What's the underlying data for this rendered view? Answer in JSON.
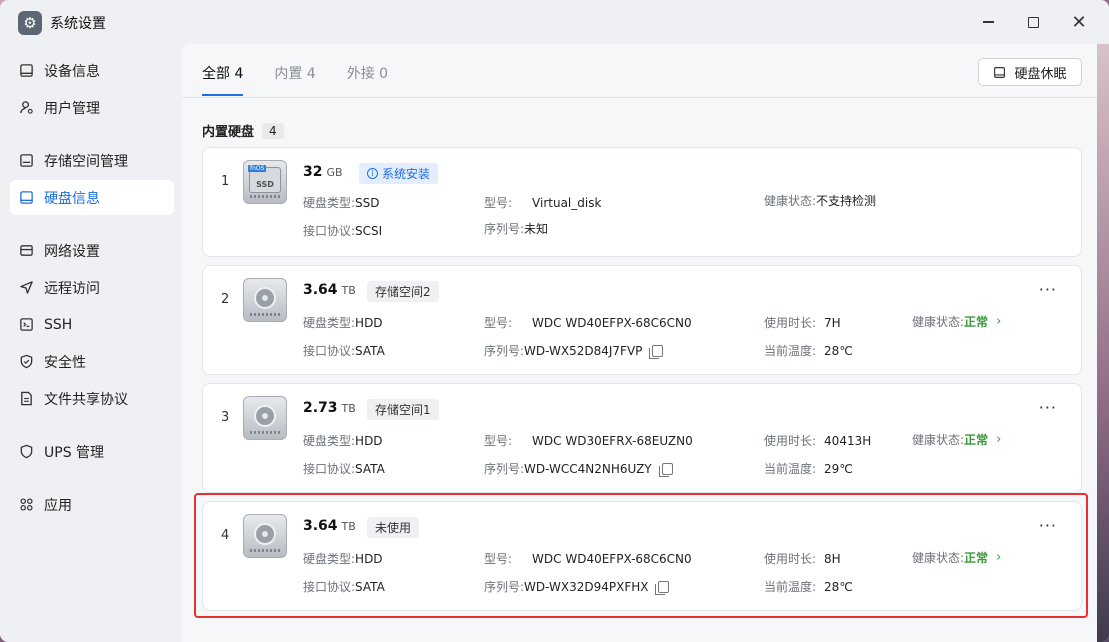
{
  "window": {
    "title": "系统设置"
  },
  "sidebar": {
    "items": [
      {
        "label": "设备信息",
        "icon": "device-icon",
        "active": false
      },
      {
        "label": "用户管理",
        "icon": "user-icon",
        "active": false
      },
      {
        "label": "存储空间管理",
        "icon": "storage-icon",
        "active": false
      },
      {
        "label": "硬盘信息",
        "icon": "disk-icon",
        "active": true
      },
      {
        "label": "网络设置",
        "icon": "network-icon",
        "active": false
      },
      {
        "label": "远程访问",
        "icon": "remote-icon",
        "active": false
      },
      {
        "label": "SSH",
        "icon": "terminal-icon",
        "active": false
      },
      {
        "label": "安全性",
        "icon": "shield-icon",
        "active": false
      },
      {
        "label": "文件共享协议",
        "icon": "file-icon",
        "active": false
      },
      {
        "label": "UPS 管理",
        "icon": "ups-icon",
        "active": false
      },
      {
        "label": "应用",
        "icon": "apps-icon",
        "active": false
      }
    ]
  },
  "tabs": [
    {
      "label": "全部 4",
      "active": true
    },
    {
      "label": "内置 4",
      "active": false
    },
    {
      "label": "外接 0",
      "active": false
    }
  ],
  "toolbar": {
    "sleep_label": "硬盘休眠"
  },
  "section": {
    "title": "内置硬盘",
    "count": "4"
  },
  "disks": [
    {
      "index": "1",
      "size": "32",
      "unit": "GB",
      "tag": "系统安装",
      "type_label": "硬盘类型:",
      "type": "SSD",
      "model_label": "型号:",
      "model": "Virtual_disk",
      "health_label": "健康状态:",
      "health": "不支持检测",
      "iface_label": "接口协议:",
      "iface": "SCSI",
      "serial_label": "序列号:",
      "serial": "未知"
    },
    {
      "index": "2",
      "size": "3.64",
      "unit": "TB",
      "tag": "存储空间2",
      "type_label": "硬盘类型:",
      "type": "HDD",
      "model_label": "型号:",
      "model": "WDC WD40EFPX-68C6CN0",
      "uptime_label": "使用时长:",
      "uptime": "7H",
      "health_label": "健康状态:",
      "health": "正常",
      "iface_label": "接口协议:",
      "iface": "SATA",
      "serial_label": "序列号:",
      "serial": "WD-WX52D84J7FVP",
      "temp_label": "当前温度:",
      "temp": "28℃"
    },
    {
      "index": "3",
      "size": "2.73",
      "unit": "TB",
      "tag": "存储空间1",
      "type_label": "硬盘类型:",
      "type": "HDD",
      "model_label": "型号:",
      "model": "WDC WD30EFRX-68EUZN0",
      "uptime_label": "使用时长:",
      "uptime": "40413H",
      "health_label": "健康状态:",
      "health": "正常",
      "iface_label": "接口协议:",
      "iface": "SATA",
      "serial_label": "序列号:",
      "serial": "WD-WCC4N2NH6UZY",
      "temp_label": "当前温度:",
      "temp": "29℃"
    },
    {
      "index": "4",
      "size": "3.64",
      "unit": "TB",
      "tag": "未使用",
      "type_label": "硬盘类型:",
      "type": "HDD",
      "model_label": "型号:",
      "model": "WDC WD40EFPX-68C6CN0",
      "uptime_label": "使用时长:",
      "uptime": "8H",
      "health_label": "健康状态:",
      "health": "正常",
      "iface_label": "接口协议:",
      "iface": "SATA",
      "serial_label": "序列号:",
      "serial": "WD-WX32D94PXFHX",
      "temp_label": "当前温度:",
      "temp": "28℃"
    }
  ],
  "colors": {
    "accent": "#1f6fe0",
    "ok": "#3a9a3a",
    "highlight": "#e8302e"
  }
}
